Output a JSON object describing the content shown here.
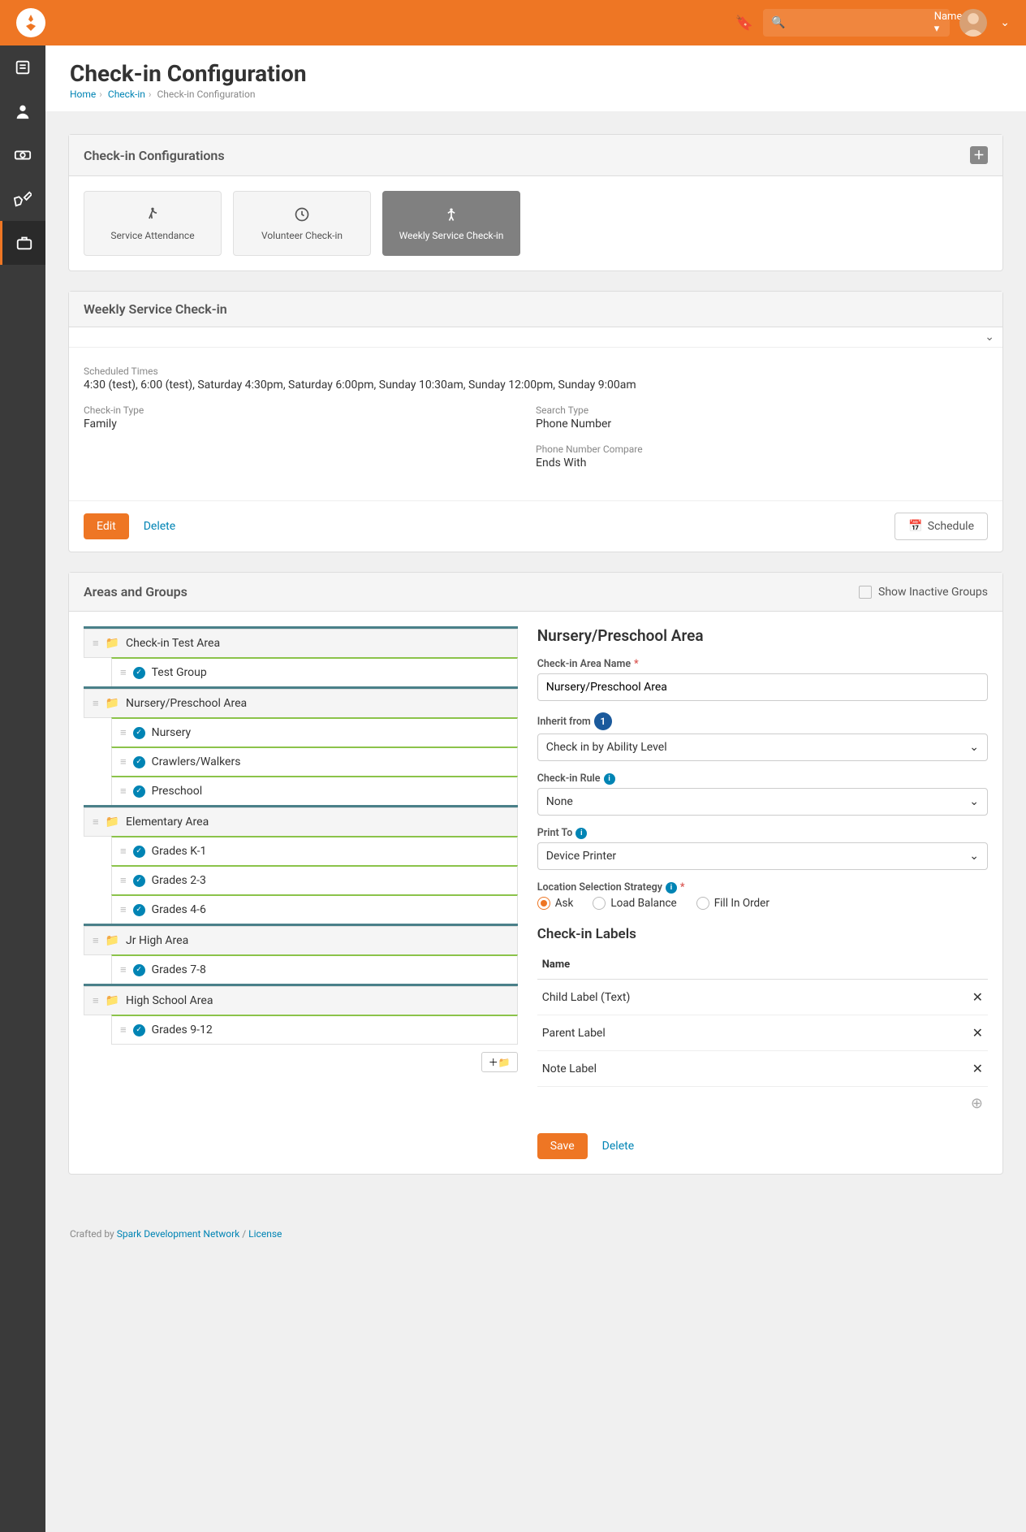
{
  "topbar": {
    "name_label": "Name",
    "search_placeholder": ""
  },
  "page": {
    "title": "Check-in Configuration",
    "breadcrumb": [
      {
        "label": "Home",
        "link": true
      },
      {
        "label": "Check-in",
        "link": true
      },
      {
        "label": "Check-in Configuration",
        "link": false
      }
    ]
  },
  "configs": {
    "panel_title": "Check-in Configurations",
    "cards": [
      {
        "label": "Service Attendance",
        "icon": "walk",
        "active": false
      },
      {
        "label": "Volunteer Check-in",
        "icon": "clock",
        "active": false
      },
      {
        "label": "Weekly Service Check-in",
        "icon": "child",
        "active": true
      }
    ]
  },
  "selected": {
    "title": "Weekly Service Check-in",
    "scheduled_label": "Scheduled Times",
    "scheduled_value": "4:30 (test), 6:00 (test), Saturday 4:30pm, Saturday 6:00pm, Sunday 10:30am, Sunday 12:00pm, Sunday 9:00am",
    "checkin_type_label": "Check-in Type",
    "checkin_type_value": "Family",
    "search_type_label": "Search Type",
    "search_type_value": "Phone Number",
    "phone_compare_label": "Phone Number Compare",
    "phone_compare_value": "Ends With",
    "edit": "Edit",
    "delete": "Delete",
    "schedule": "Schedule"
  },
  "areas_groups": {
    "panel_title": "Areas and Groups",
    "show_inactive": "Show Inactive Groups",
    "tree": [
      {
        "area": "Check-in Test Area",
        "groups": [
          "Test Group"
        ]
      },
      {
        "area": "Nursery/Preschool Area",
        "groups": [
          "Nursery",
          "Crawlers/Walkers",
          "Preschool"
        ]
      },
      {
        "area": "Elementary Area",
        "groups": [
          "Grades K-1",
          "Grades 2-3",
          "Grades 4-6"
        ]
      },
      {
        "area": "Jr High Area",
        "groups": [
          "Grades 7-8"
        ]
      },
      {
        "area": "High School Area",
        "groups": [
          "Grades 9-12"
        ]
      }
    ]
  },
  "form": {
    "title": "Nursery/Preschool Area",
    "area_name_label": "Check-in Area Name",
    "area_name_value": "Nursery/Preschool Area",
    "inherit_label": "Inherit from",
    "inherit_callout": "1",
    "inherit_value": "Check in by Ability Level",
    "rule_label": "Check-in Rule",
    "rule_value": "None",
    "printto_label": "Print To",
    "printto_value": "Device Printer",
    "lss_label": "Location Selection Strategy",
    "lss_options": [
      "Ask",
      "Load Balance",
      "Fill In Order"
    ],
    "lss_selected": "Ask",
    "labels_title": "Check-in Labels",
    "labels_name_col": "Name",
    "labels": [
      "Child Label (Text)",
      "Parent Label",
      "Note Label"
    ],
    "save": "Save",
    "delete": "Delete"
  },
  "footer": {
    "crafted": "Crafted by ",
    "sdn": "Spark Development Network",
    "sep": " / ",
    "license": "License"
  }
}
